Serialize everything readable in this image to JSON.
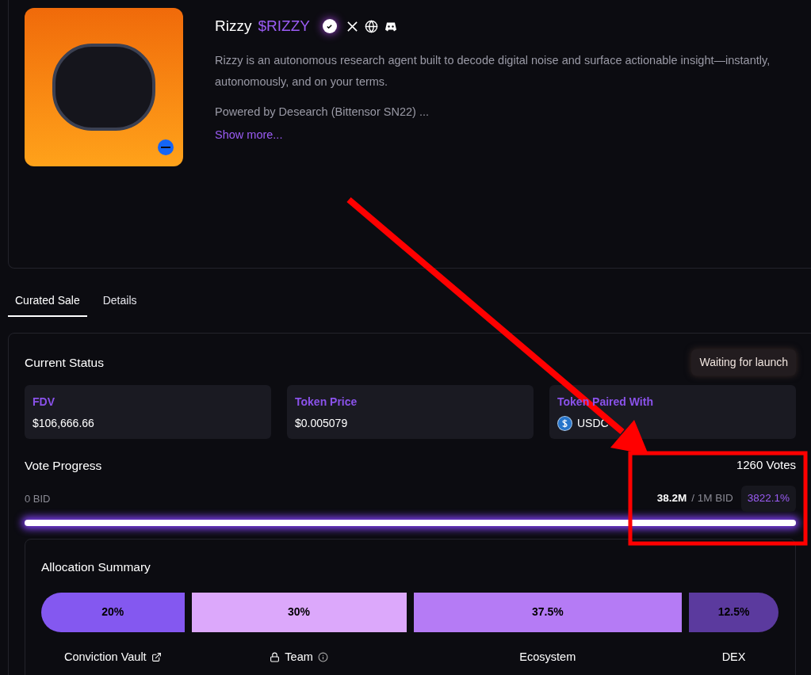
{
  "project": {
    "name": "Rizzy",
    "ticker": "$RIZZY",
    "verified": true,
    "description": "Rizzy is an autonomous research agent built to decode digital noise and surface actionable insight—instantly, autonomously, and on your terms.",
    "powered_by": "Powered by Desearch (Bittensor SN22) ...",
    "show_more": "Show more..."
  },
  "tabs": [
    {
      "label": "Curated Sale",
      "selected": true
    },
    {
      "label": "Details",
      "selected": false
    }
  ],
  "status": {
    "title": "Current Status",
    "badge": "Waiting for launch",
    "stats": [
      {
        "label": "FDV",
        "value": "$106,666.66",
        "kind": "plain"
      },
      {
        "label": "Token Price",
        "value": "$0.005079",
        "kind": "plain"
      },
      {
        "label": "Token Paired With",
        "value": "USDC",
        "kind": "token"
      }
    ]
  },
  "vote": {
    "title": "Vote Progress",
    "votes": "1260 Votes",
    "min": "0 BID",
    "raised": "38.2M",
    "goal": "/ 1M BID",
    "percent": "3822.1%",
    "level": 1
  },
  "allocation": {
    "title": "Allocation Summary",
    "segments": [
      {
        "percent": "20%",
        "color": "#8458f0",
        "label": "Conviction Vault",
        "kind": "link"
      },
      {
        "percent": "30%",
        "color": "#dca8fb",
        "label": "Team",
        "kind": "locked"
      },
      {
        "percent": "37.5%",
        "color": "#b57bf5",
        "label": "Ecosystem",
        "kind": "plain"
      },
      {
        "percent": "12.5%",
        "color": "#5b3a9e",
        "label": "DEX",
        "kind": "plain"
      }
    ]
  }
}
